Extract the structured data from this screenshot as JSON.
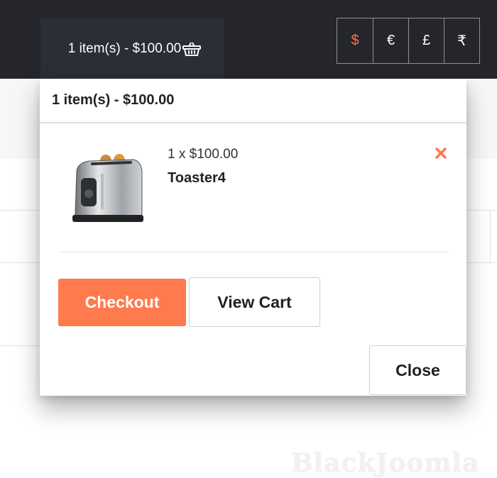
{
  "header": {
    "cart_summary": "1 item(s) - $100.00",
    "cart_icon": "basket-icon",
    "currencies": [
      {
        "symbol": "$",
        "active": true
      },
      {
        "symbol": "€",
        "active": false
      },
      {
        "symbol": "£",
        "active": false
      },
      {
        "symbol": "₹",
        "active": false
      }
    ]
  },
  "cart_dropdown": {
    "title": "1 item(s) - $100.00",
    "items": [
      {
        "qty_price": "1 x $100.00",
        "name": "Toaster4",
        "image": "toaster-icon",
        "remove_icon": "close-icon"
      }
    ],
    "checkout_label": "Checkout",
    "view_cart_label": "View Cart",
    "close_label": "Close"
  },
  "watermark": "BlackJoomla",
  "colors": {
    "accent": "#ff7a4d",
    "topbar": "#24262c",
    "active_currency": "#ff7043"
  }
}
